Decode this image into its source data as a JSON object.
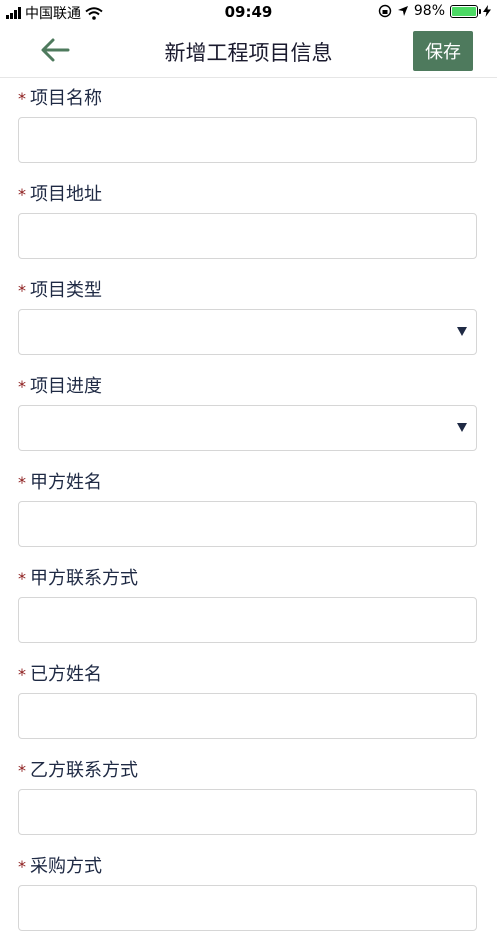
{
  "status": {
    "carrier": "中国联通",
    "time": "09:49",
    "battery": "98%",
    "battery_level": 0.98
  },
  "nav": {
    "title": "新增工程项目信息",
    "save_label": "保存",
    "back_icon": "arrow-left-icon",
    "accent": "#4e7a5d"
  },
  "form": {
    "required_mark": "*",
    "fields": [
      {
        "label": "项目名称",
        "type": "text",
        "value": ""
      },
      {
        "label": "项目地址",
        "type": "text",
        "value": ""
      },
      {
        "label": "项目类型",
        "type": "select",
        "value": ""
      },
      {
        "label": "项目进度",
        "type": "select",
        "value": ""
      },
      {
        "label": "甲方姓名",
        "type": "text",
        "value": ""
      },
      {
        "label": "甲方联系方式",
        "type": "text",
        "value": ""
      },
      {
        "label": "已方姓名",
        "type": "text",
        "value": ""
      },
      {
        "label": "乙方联系方式",
        "type": "text",
        "value": ""
      },
      {
        "label": "采购方式",
        "type": "text",
        "value": ""
      }
    ]
  }
}
